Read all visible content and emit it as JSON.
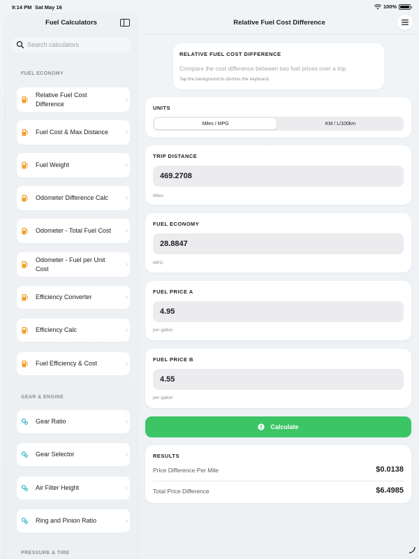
{
  "status_bar": {
    "time": "9:14 PM",
    "date": "Sat May 16",
    "battery": "100%"
  },
  "sidebar": {
    "title": "Fuel Calculators",
    "search_placeholder": "Search calculators",
    "sections": [
      {
        "header": "FUEL ECONOMY",
        "items": [
          {
            "label": "Relative Fuel Cost Difference",
            "icon": "fuel-pump-icon"
          },
          {
            "label": "Fuel Cost & Max Distance",
            "icon": "fuel-pump-icon"
          },
          {
            "label": "Fuel Weight",
            "icon": "fuel-pump-icon"
          },
          {
            "label": "Odometer Difference Calc",
            "icon": "fuel-pump-icon"
          },
          {
            "label": "Odometer - Total Fuel Cost",
            "icon": "fuel-pump-icon"
          },
          {
            "label": "Odometer - Fuel per Unit Cost",
            "icon": "fuel-pump-icon"
          },
          {
            "label": "Efficiency Converter",
            "icon": "fuel-pump-icon"
          },
          {
            "label": "Efficiency Calc",
            "icon": "fuel-pump-icon"
          },
          {
            "label": "Fuel Efficiency & Cost",
            "icon": "fuel-pump-icon"
          }
        ]
      },
      {
        "header": "GEAR & ENGINE",
        "items": [
          {
            "label": "Gear Ratio",
            "icon": "gears-icon"
          },
          {
            "label": "Gear Selector",
            "icon": "gears-icon"
          },
          {
            "label": "Air Filter Height",
            "icon": "gears-icon"
          },
          {
            "label": "Ring and Pinion Ratio",
            "icon": "gears-icon"
          }
        ]
      },
      {
        "header": "PRESSURE & TIRE",
        "items": []
      }
    ]
  },
  "main": {
    "title": "Relative Fuel Cost Difference",
    "info": {
      "heading": "RELATIVE FUEL COST DIFFERENCE",
      "description": "Compare the cost difference between two fuel prices over a trip.",
      "hint": "Tap the background to dismiss the keyboard."
    },
    "units": {
      "label": "UNITS",
      "options": [
        "Miles / MPG",
        "KM / L/100km"
      ],
      "selected": "Miles / MPG"
    },
    "fields": [
      {
        "label": "TRIP DISTANCE",
        "value": "469.2708",
        "unit": "Miles"
      },
      {
        "label": "FUEL ECONOMY",
        "value": "28.8847",
        "unit": "MPG"
      },
      {
        "label": "FUEL PRICE A",
        "value": "4.95",
        "unit": "per gallon"
      },
      {
        "label": "FUEL PRICE B",
        "value": "4.55",
        "unit": "per gallon"
      }
    ],
    "calculate_label": "Calculate",
    "results": {
      "heading": "RESULTS",
      "rows": [
        {
          "label": "Price Difference Per Mile",
          "value": "$0.0138"
        },
        {
          "label": "Total Price Difference",
          "value": "$6.4985"
        }
      ]
    }
  },
  "colors": {
    "accent_green": "#3cc565",
    "fuel_icon_orange": "#f0a030",
    "gear_icon_teal": "#35b6c9"
  }
}
